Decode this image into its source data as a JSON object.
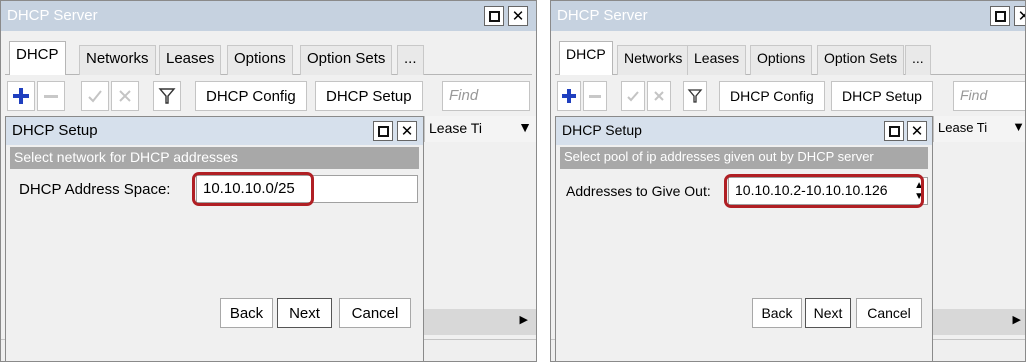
{
  "left": {
    "window_title": "DHCP Server",
    "tabs": [
      {
        "label": "DHCP"
      },
      {
        "label": "Networks"
      },
      {
        "label": "Leases"
      },
      {
        "label": "Options"
      },
      {
        "label": "Option Sets"
      },
      {
        "label": "..."
      }
    ],
    "toolbar": {
      "config_label": "DHCP Config",
      "setup_label": "DHCP Setup",
      "find_placeholder": "Find"
    },
    "column_header": "Lease Ti",
    "dialog": {
      "title": "DHCP Setup",
      "subtitle": "Select network for DHCP addresses",
      "field_label": "DHCP Address Space:",
      "field_value": "10.10.10.0/25",
      "back_label": "Back",
      "next_label": "Next",
      "cancel_label": "Cancel"
    }
  },
  "right": {
    "window_title": "DHCP Server",
    "tabs": [
      {
        "label": "DHCP"
      },
      {
        "label": "Networks"
      },
      {
        "label": "Leases"
      },
      {
        "label": "Options"
      },
      {
        "label": "Option Sets"
      },
      {
        "label": "..."
      }
    ],
    "toolbar": {
      "config_label": "DHCP Config",
      "setup_label": "DHCP Setup",
      "find_placeholder": "Find"
    },
    "column_header": "Lease Ti",
    "dialog": {
      "title": "DHCP Setup",
      "subtitle": "Select pool of ip addresses given out by DHCP server",
      "field_label": "Addresses to Give Out:",
      "field_value": "10.10.10.2-10.10.10.126",
      "back_label": "Back",
      "next_label": "Next",
      "cancel_label": "Cancel"
    }
  },
  "colors": {
    "highlight": "#b01f24",
    "add_icon": "#1f3fbf",
    "title_bar": "#c6d2e0"
  }
}
